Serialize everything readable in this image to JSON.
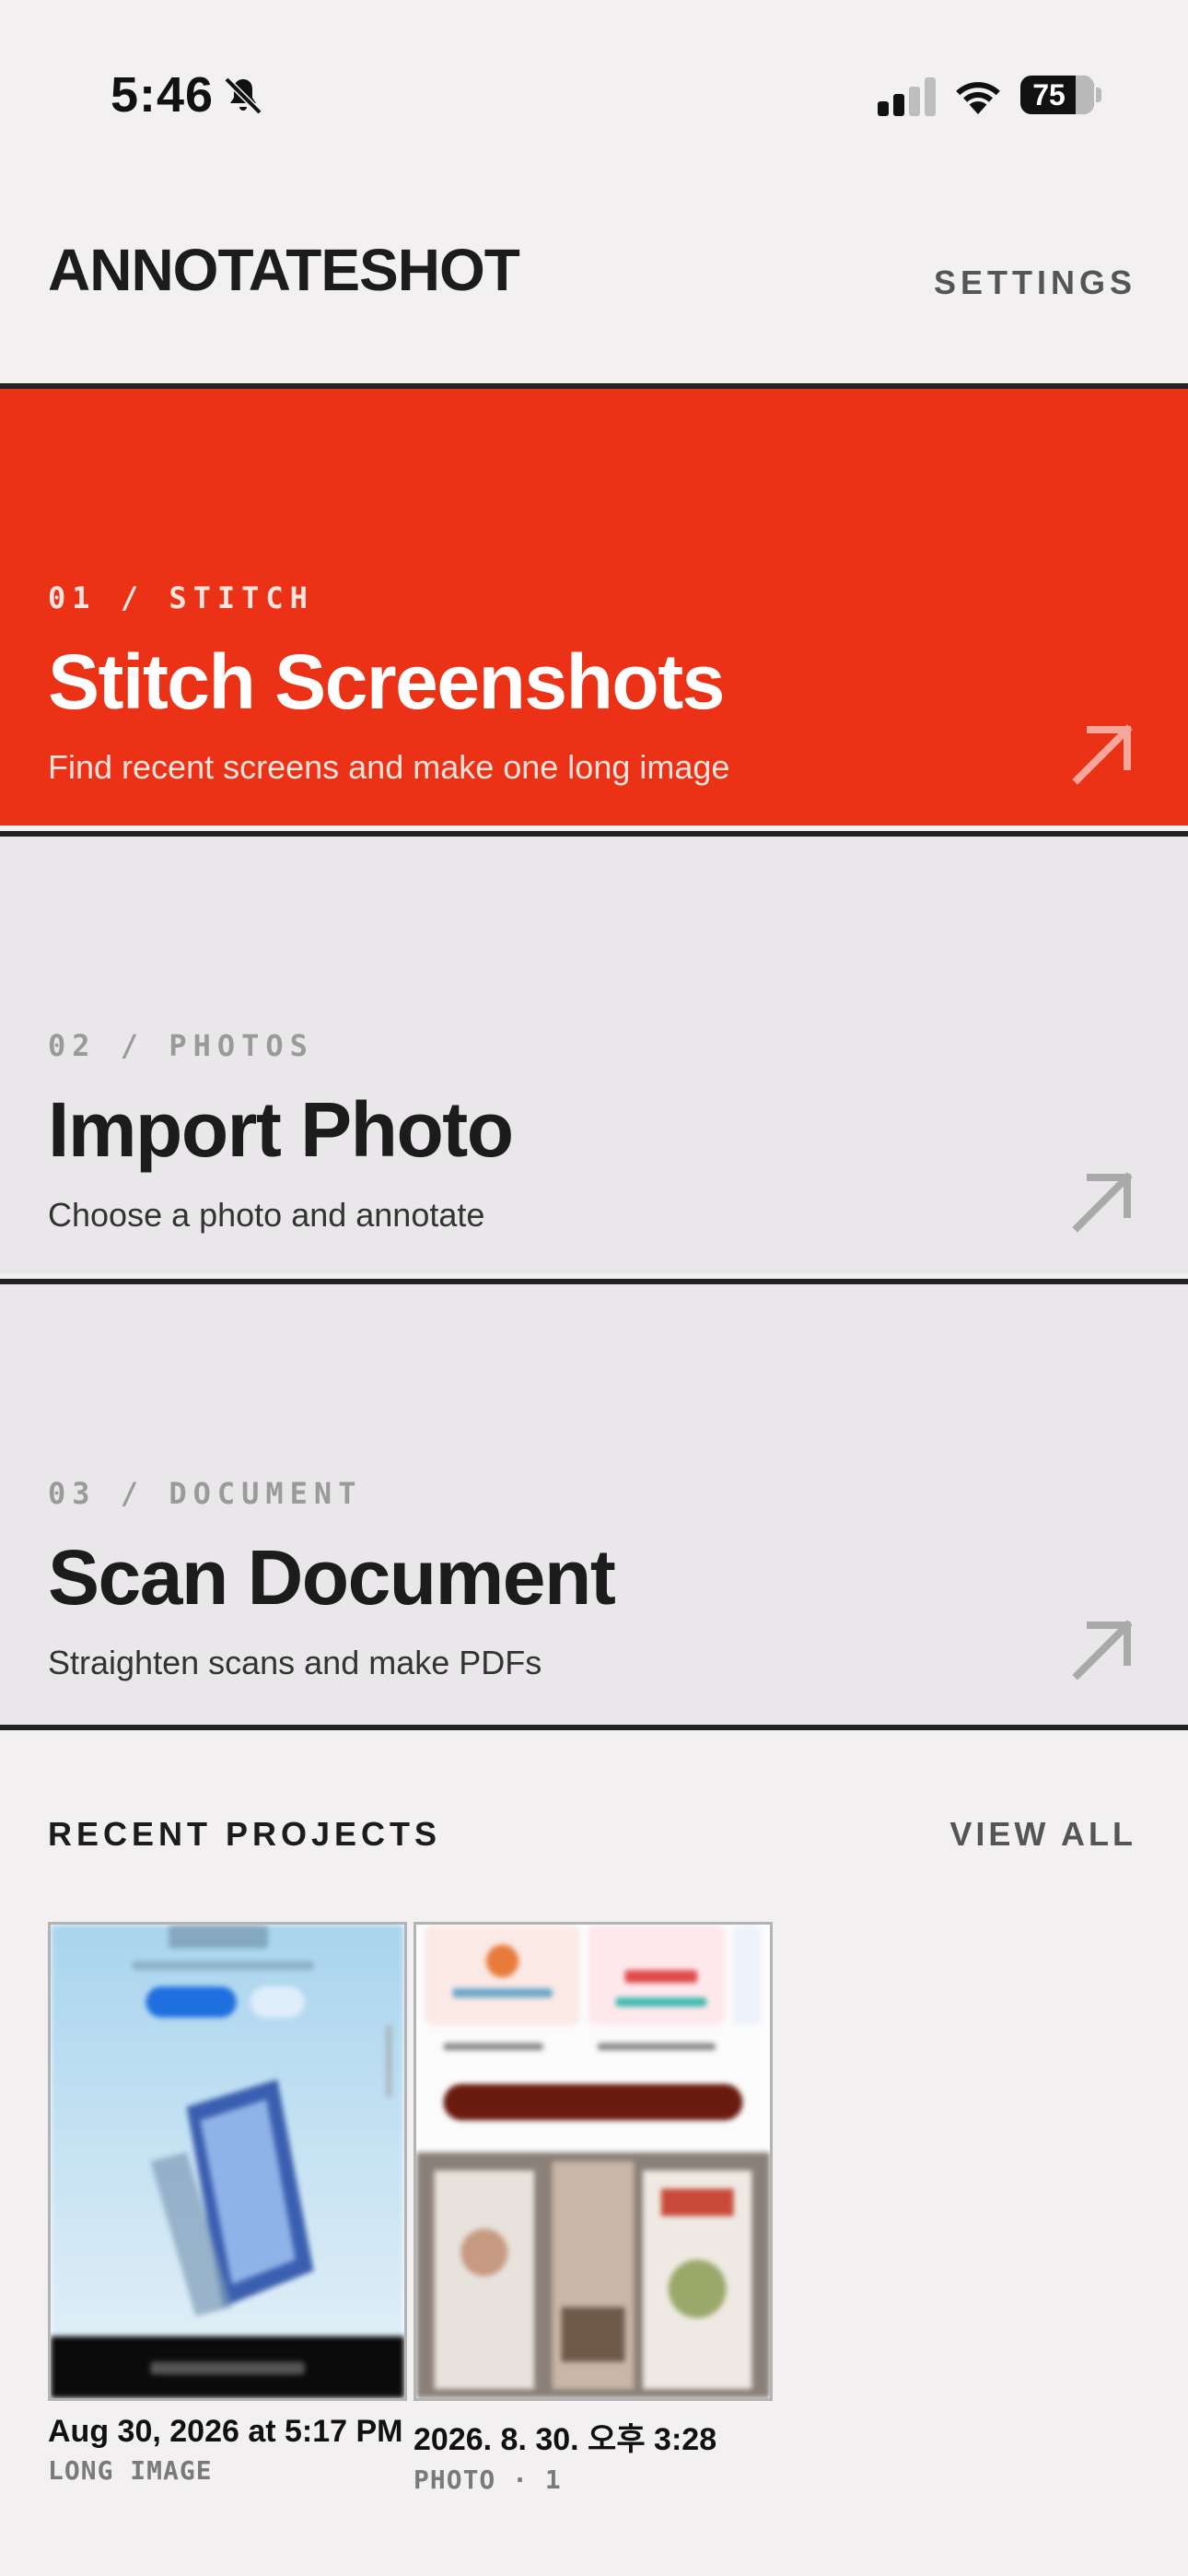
{
  "status_bar": {
    "time": "5:46",
    "battery": "75",
    "icons": [
      "bell-slash-icon",
      "cellular-signal-icon",
      "wifi-icon",
      "battery-icon"
    ]
  },
  "header": {
    "title": "ANNOTATESHOT",
    "settings_label": "SETTINGS"
  },
  "tiles": [
    {
      "kicker": "01 / STITCH",
      "title": "Stitch Screenshots",
      "subtitle": "Find recent screens and make one long image",
      "icon": "arrow-up-right-icon",
      "color": "#ec3216"
    },
    {
      "kicker": "02 / PHOTOS",
      "title": "Import Photo",
      "subtitle": "Choose a photo and annotate",
      "icon": "arrow-up-right-icon",
      "color": "#e9e7e9"
    },
    {
      "kicker": "03 / DOCUMENT",
      "title": "Scan Document",
      "subtitle": "Straighten scans and make PDFs",
      "icon": "arrow-up-right-icon",
      "color": "#e9e7e9"
    }
  ],
  "recent": {
    "heading": "RECENT PROJECTS",
    "view_all_label": "VIEW ALL",
    "projects": [
      {
        "date": "Aug 30, 2026 at 5:17 PM",
        "meta": "LONG IMAGE"
      },
      {
        "date": "2026. 8. 30. 오후 3:28",
        "meta": "PHOTO · 1"
      }
    ]
  },
  "colors": {
    "accent": "#ec3216",
    "background": "#f2f0f1",
    "tile_neutral": "#e9e7e9",
    "text": "#1c1c1c"
  }
}
